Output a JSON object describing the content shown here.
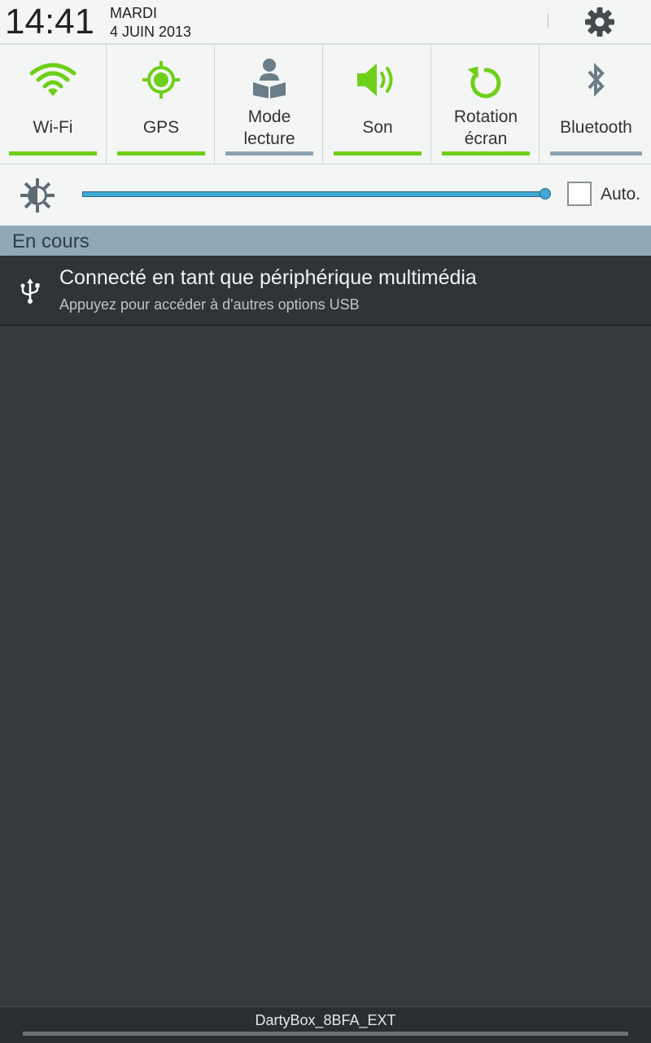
{
  "status": {
    "time": "14:41",
    "day": "MARDI",
    "date": "4 JUIN 2013"
  },
  "quick_settings": [
    {
      "label_lines": [
        "Wi-Fi"
      ],
      "icon": "wifi-icon",
      "enabled": true
    },
    {
      "label_lines": [
        "GPS"
      ],
      "icon": "gps-icon",
      "enabled": true
    },
    {
      "label_lines": [
        "Mode",
        "lecture"
      ],
      "icon": "reading-mode-icon",
      "enabled": false
    },
    {
      "label_lines": [
        "Son"
      ],
      "icon": "sound-icon",
      "enabled": true
    },
    {
      "label_lines": [
        "Rotation",
        "écran"
      ],
      "icon": "rotation-icon",
      "enabled": true
    },
    {
      "label_lines": [
        "Bluetooth"
      ],
      "icon": "bluetooth-icon",
      "enabled": false
    }
  ],
  "brightness": {
    "level_fraction": 1.0,
    "auto_label": "Auto.",
    "auto_checked": false
  },
  "section_title": "En cours",
  "notification": {
    "icon": "usb-icon",
    "title": "Connecté en tant que périphérique multimédia",
    "subtitle": "Appuyez pour accéder à d'autres options USB"
  },
  "bottom": {
    "network": "DartyBox_8BFA_EXT"
  },
  "colors": {
    "active": "#6dd018",
    "inactive": "#8fa3ae",
    "slider": "#40a9d4",
    "section": "#8fa9b9"
  }
}
